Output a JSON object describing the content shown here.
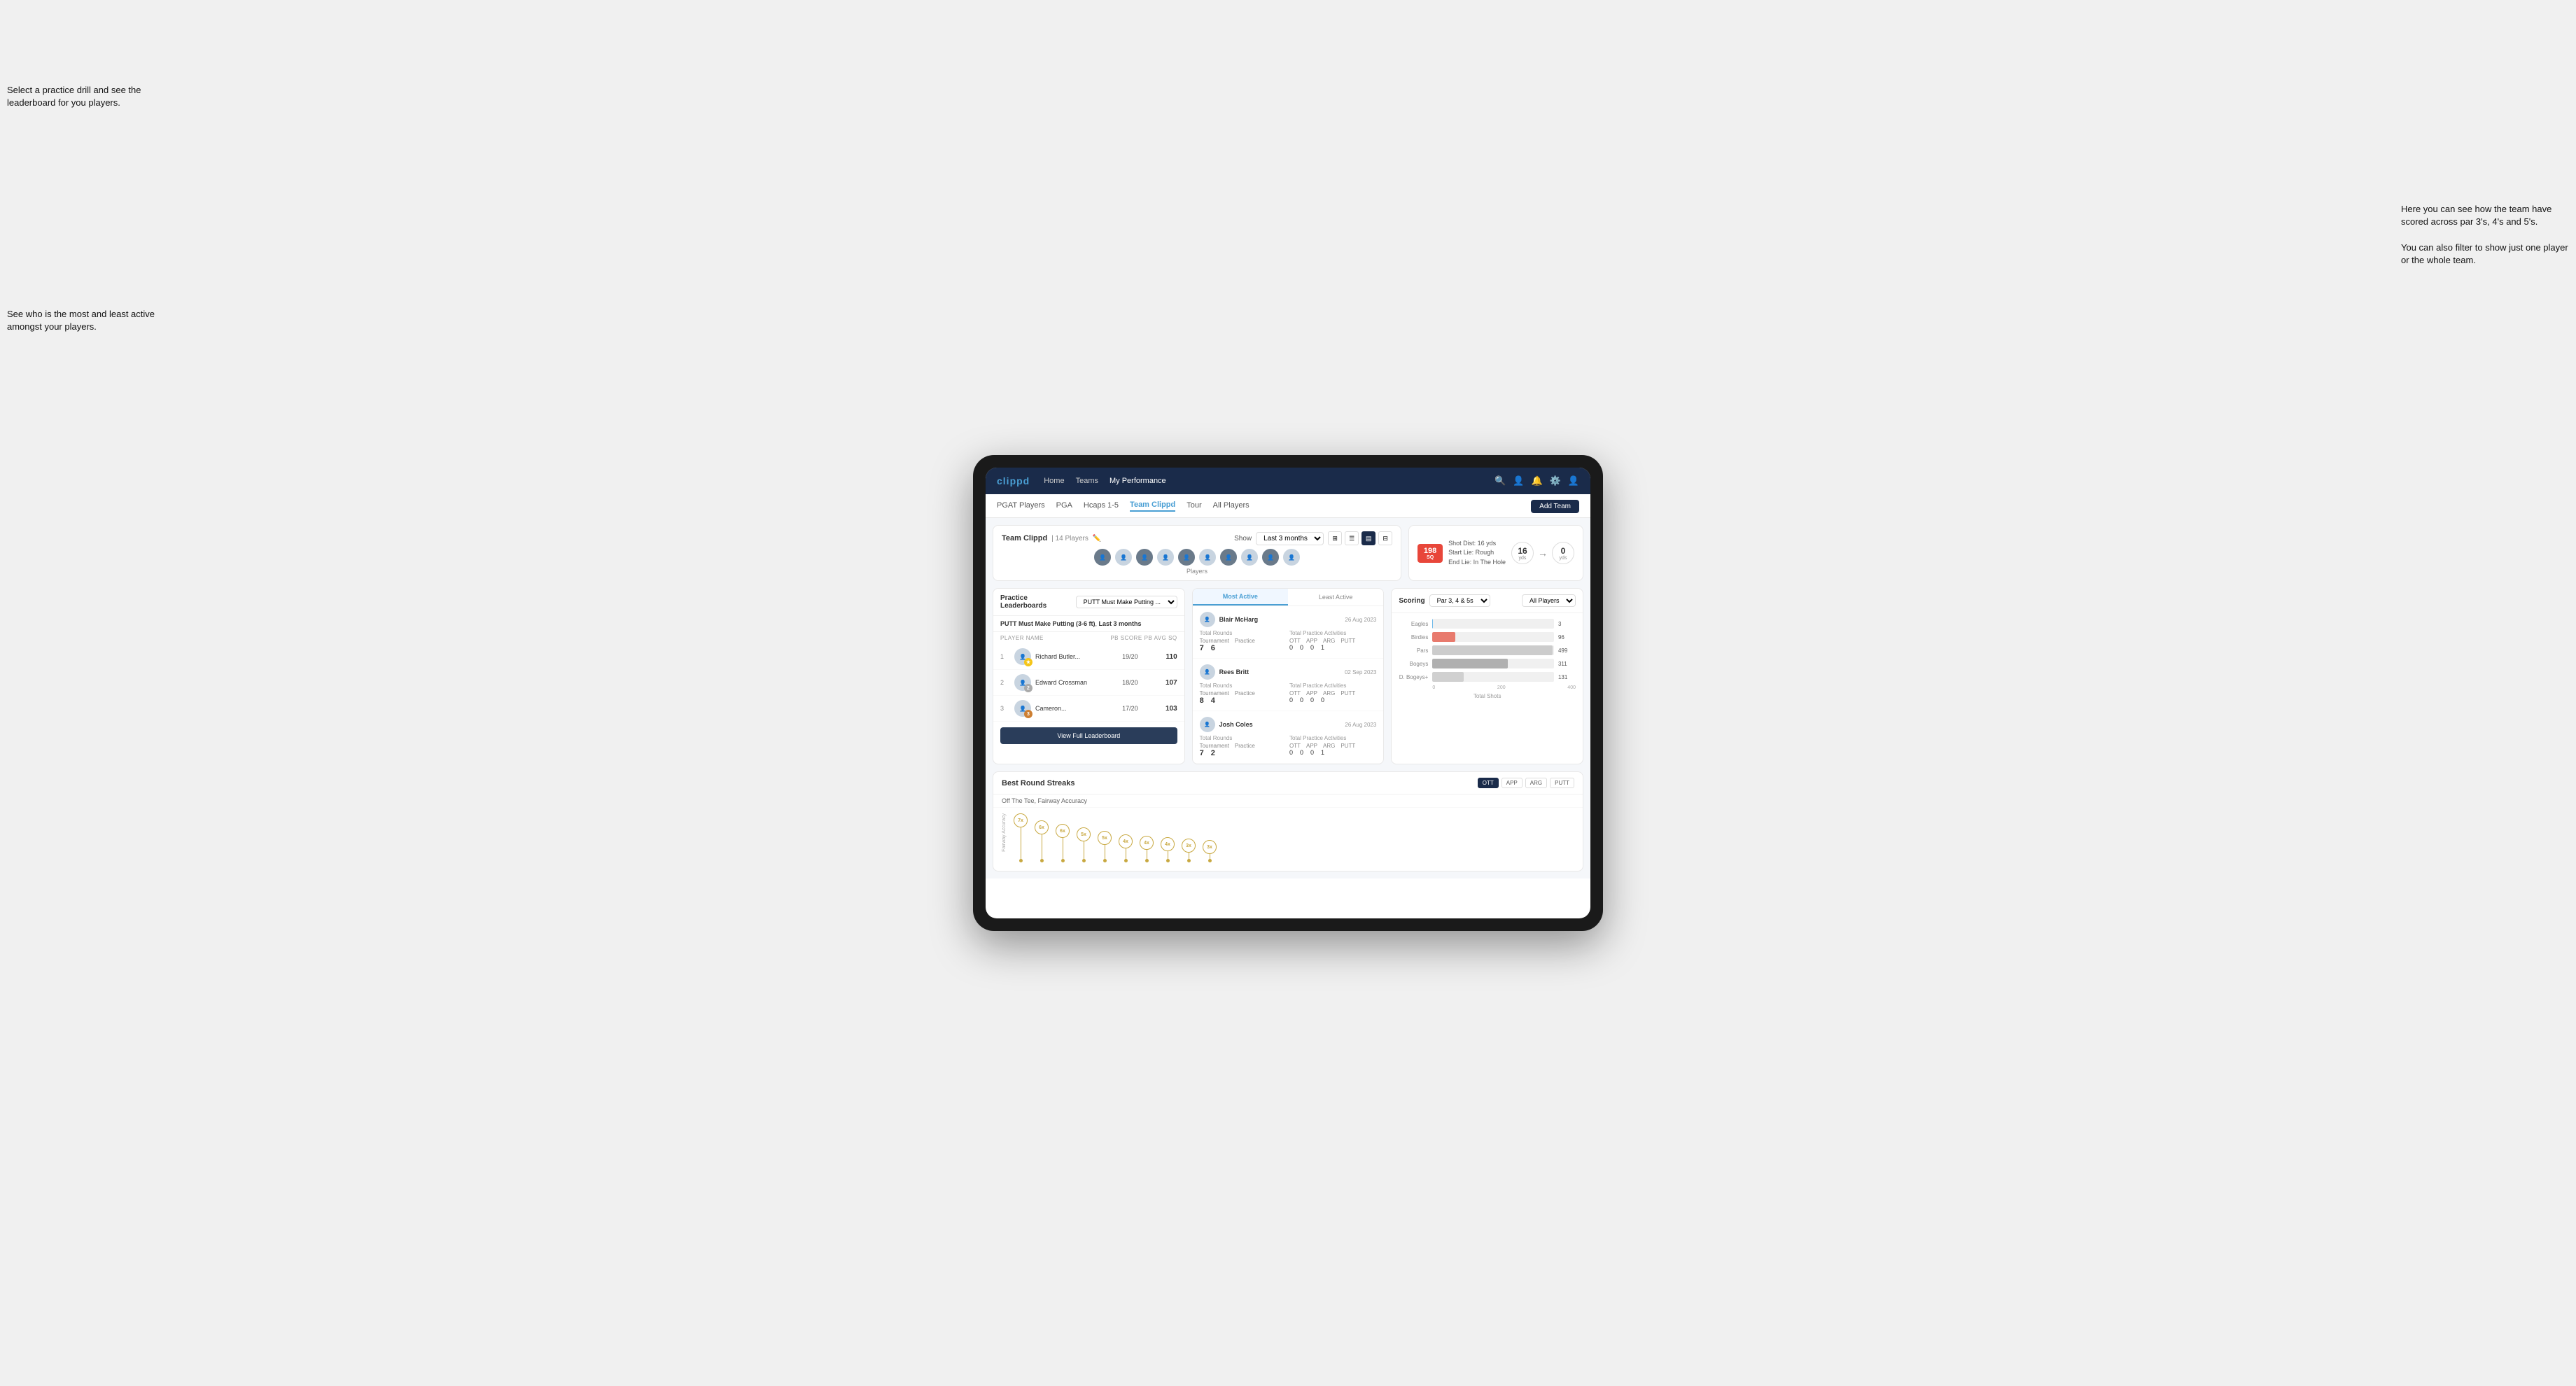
{
  "annotations": {
    "top_left": "Select a practice drill and see the leaderboard for you players.",
    "bottom_left": "See who is the most and least active amongst your players.",
    "right": "Here you can see how the team have scored across par 3's, 4's and 5's.\n\nYou can also filter to show just one player or the whole team."
  },
  "nav": {
    "logo": "clippd",
    "links": [
      "Home",
      "Teams",
      "My Performance"
    ],
    "active_link": "My Performance"
  },
  "sub_nav": {
    "links": [
      "PGAT Players",
      "PGA",
      "Hcaps 1-5",
      "Team Clippd",
      "Tour",
      "All Players"
    ],
    "active_link": "Team Clippd",
    "add_team_label": "Add Team"
  },
  "team_header": {
    "title": "Team Clippd",
    "count": "14 Players",
    "show_label": "Show",
    "show_value": "Last 3 months",
    "players_label": "Players"
  },
  "shot_card": {
    "badge": "198",
    "badge_sub": "SQ",
    "info_line1": "Shot Dist: 16 yds",
    "info_line2": "Start Lie: Rough",
    "info_line3": "End Lie: In The Hole",
    "circle1_num": "16",
    "circle1_lbl": "yds",
    "circle2_num": "0",
    "circle2_lbl": "yds"
  },
  "practice_leaderboard": {
    "card_title": "Practice Leaderboards",
    "dropdown_label": "PUTT Must Make Putting ...",
    "subtitle_drill": "PUTT Must Make Putting (3-6 ft)",
    "subtitle_period": "Last 3 months",
    "col_player": "PLAYER NAME",
    "col_score": "PB SCORE",
    "col_avg": "PB AVG SQ",
    "players": [
      {
        "rank": 1,
        "name": "Richard Butler...",
        "score": "19/20",
        "avg": "110",
        "badge_type": "gold",
        "badge_num": ""
      },
      {
        "rank": 2,
        "name": "Edward Crossman",
        "score": "18/20",
        "avg": "107",
        "badge_type": "silver",
        "badge_num": "2"
      },
      {
        "rank": 3,
        "name": "Cameron...",
        "score": "17/20",
        "avg": "103",
        "badge_type": "bronze",
        "badge_num": "3"
      }
    ],
    "view_full_label": "View Full Leaderboard"
  },
  "most_active": {
    "toggle_most": "Most Active",
    "toggle_least": "Least Active",
    "players": [
      {
        "name": "Blair McHarg",
        "date": "26 Aug 2023",
        "total_rounds_label": "Total Rounds",
        "tournament": "7",
        "practice": "6",
        "total_practice_label": "Total Practice Activities",
        "ott": "0",
        "app": "0",
        "arg": "0",
        "putt": "1"
      },
      {
        "name": "Rees Britt",
        "date": "02 Sep 2023",
        "total_rounds_label": "Total Rounds",
        "tournament": "8",
        "practice": "4",
        "total_practice_label": "Total Practice Activities",
        "ott": "0",
        "app": "0",
        "arg": "0",
        "putt": "0"
      },
      {
        "name": "Josh Coles",
        "date": "26 Aug 2023",
        "total_rounds_label": "Total Rounds",
        "tournament": "7",
        "practice": "2",
        "total_practice_label": "Total Practice Activities",
        "ott": "0",
        "app": "0",
        "arg": "0",
        "putt": "1"
      }
    ]
  },
  "scoring": {
    "title": "Scoring",
    "filter_label": "Par 3, 4 & 5s",
    "player_filter": "All Players",
    "bars": [
      {
        "label": "Eagles",
        "value": 3,
        "max": 500,
        "class": "eagles"
      },
      {
        "label": "Birdies",
        "value": 96,
        "max": 500,
        "class": "birdies"
      },
      {
        "label": "Pars",
        "value": 499,
        "max": 500,
        "class": "pars"
      },
      {
        "label": "Bogeys",
        "value": 311,
        "max": 500,
        "class": "bogeys"
      },
      {
        "label": "D. Bogeys+",
        "value": 131,
        "max": 500,
        "class": "dbogeys"
      }
    ],
    "x_labels": [
      "0",
      "200",
      "400"
    ],
    "x_title": "Total Shots"
  },
  "best_round_streaks": {
    "title": "Best Round Streaks",
    "subtitle": "Off The Tee, Fairway Accuracy",
    "buttons": [
      "OTT",
      "APP",
      "ARG",
      "PUTT"
    ],
    "active_button": "OTT",
    "points": [
      {
        "val": "7x",
        "x": 8
      },
      {
        "val": "6x",
        "x": 17
      },
      {
        "val": "6x",
        "x": 26
      },
      {
        "val": "5x",
        "x": 37
      },
      {
        "val": "5x",
        "x": 46
      },
      {
        "val": "4x",
        "x": 57
      },
      {
        "val": "4x",
        "x": 66
      },
      {
        "val": "4x",
        "x": 75
      },
      {
        "val": "3x",
        "x": 84
      },
      {
        "val": "3x",
        "x": 92
      }
    ]
  }
}
